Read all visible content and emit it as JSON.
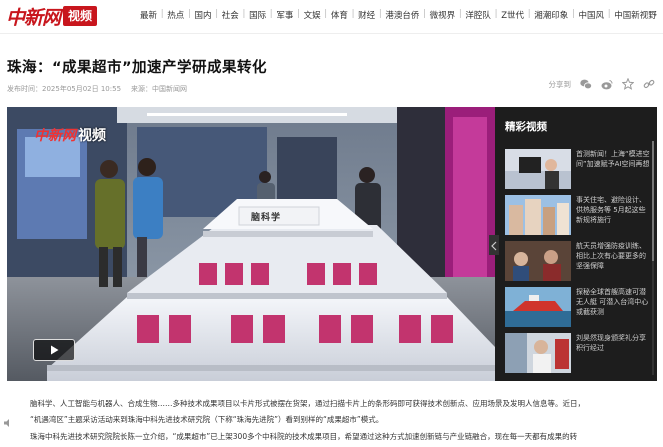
{
  "header": {
    "logo_text": "中新网",
    "logo_badge": "视频",
    "nav": [
      "最新",
      "热点",
      "国内",
      "社会",
      "国际",
      "军事",
      "文娱",
      "体育",
      "财经",
      "港澳台侨",
      "微视界",
      "洋腔队",
      "Z世代",
      "湘潮印象",
      "中国风",
      "中国新视野"
    ]
  },
  "article": {
    "title": "珠海：“成果超市”加速产学研成果转化",
    "publish_time": "发布时间：2025年05月02日 10:55",
    "source": "来源：中国新闻网"
  },
  "share": {
    "label": "分享到",
    "icons": [
      "wechat-icon",
      "weibo-icon",
      "star-icon",
      "link-icon"
    ]
  },
  "player": {
    "watermark_cn": "中新网",
    "watermark_badge": "视频",
    "sign_text": "脑科学"
  },
  "sidebar": {
    "title": "精彩视频",
    "items": [
      {
        "text": "首测新闻！上海“模进空间”加速赋予AI空间再想"
      },
      {
        "text": "事关住宅、避险设计、供热服务等 5月起这些新规将施行"
      },
      {
        "text": "航天员增强防疫训练、相比上次有心要更多的坚强保障"
      },
      {
        "text": "探秘全球首艘高速可潜无人艇 可潜入台湾中心或截获测"
      },
      {
        "text": "刘昊然现身颁奖礼分享积行经过"
      }
    ]
  },
  "body": {
    "lines": [
      "脑科学、人工智能与机器人、合成生物……多种技术成果项目以卡片形式被摆在货架，通过扫描卡片上的条形码即可获得技术创新点、应用场景及发明人信息等。近日，",
      "“机遇湾区”主题采访活动来到珠海中科先进技术研究院（下称“珠海先进院”）看到别样的“成果超市”模式。",
      "珠海中科先进技术研究院院长陈一立介绍，“成果超市”已上架300多个中科院的技术成果项目，希望通过这种方式加速创新链与产业链融合，现在每一天都有成果的转"
    ]
  },
  "colors": {
    "brand_red": "#c8161d",
    "sidebar_bg": "#1d1d1d"
  }
}
